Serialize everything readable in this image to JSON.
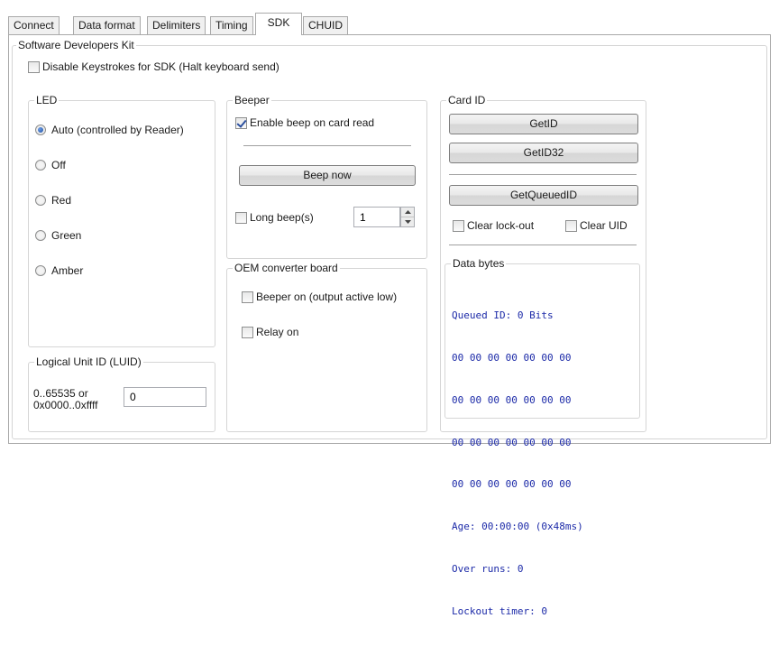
{
  "tabs": [
    {
      "label": "Connect"
    },
    {
      "label": "Data format"
    },
    {
      "label": "Delimiters"
    },
    {
      "label": "Timing"
    },
    {
      "label": "SDK"
    },
    {
      "label": "CHUID"
    }
  ],
  "active_tab": "SDK",
  "sdk_group": {
    "title": "Software Developers Kit",
    "disable_keystrokes": {
      "label": "Disable Keystrokes for SDK (Halt keyboard send)",
      "checked": false
    }
  },
  "led": {
    "title": "LED",
    "options": [
      {
        "label": "Auto (controlled by Reader)",
        "checked": true
      },
      {
        "label": "Off",
        "checked": false
      },
      {
        "label": "Red",
        "checked": false
      },
      {
        "label": "Green",
        "checked": false
      },
      {
        "label": "Amber",
        "checked": false
      }
    ]
  },
  "luid": {
    "title": "Logical Unit ID (LUID)",
    "range_line1": "0..65535 or",
    "range_line2": "0x0000..0xffff",
    "value": "0"
  },
  "beeper": {
    "title": "Beeper",
    "enable_beep": {
      "label": "Enable beep on card read",
      "checked": true
    },
    "beep_now_label": "Beep now",
    "long_beep": {
      "label": "Long beep(s)",
      "checked": false
    },
    "long_beep_count": "1"
  },
  "oem": {
    "title": "OEM converter board",
    "beeper_on": {
      "label": "Beeper on (output active low)",
      "checked": false
    },
    "relay_on": {
      "label": "Relay on",
      "checked": false
    }
  },
  "card_id": {
    "title": "Card ID",
    "getid_label": "GetID",
    "getid32_label": "GetID32",
    "getqueued_label": "GetQueuedID",
    "clear_lockout": {
      "label": "Clear lock-out",
      "checked": false
    },
    "clear_uid": {
      "label": "Clear UID",
      "checked": false
    }
  },
  "data_bytes": {
    "title": "Data bytes",
    "lines": [
      "Queued ID: 0 Bits",
      "00 00 00 00 00 00 00",
      "00 00 00 00 00 00 00",
      "00 00 00 00 00 00 00",
      "00 00 00 00 00 00 00",
      "Age: 00:00:00 (0x48ms)",
      "Over runs: 0",
      "Lockout timer: 0"
    ]
  },
  "colors": {
    "data_text": "#1c2aa8",
    "check_accent": "#2b4f9e"
  }
}
